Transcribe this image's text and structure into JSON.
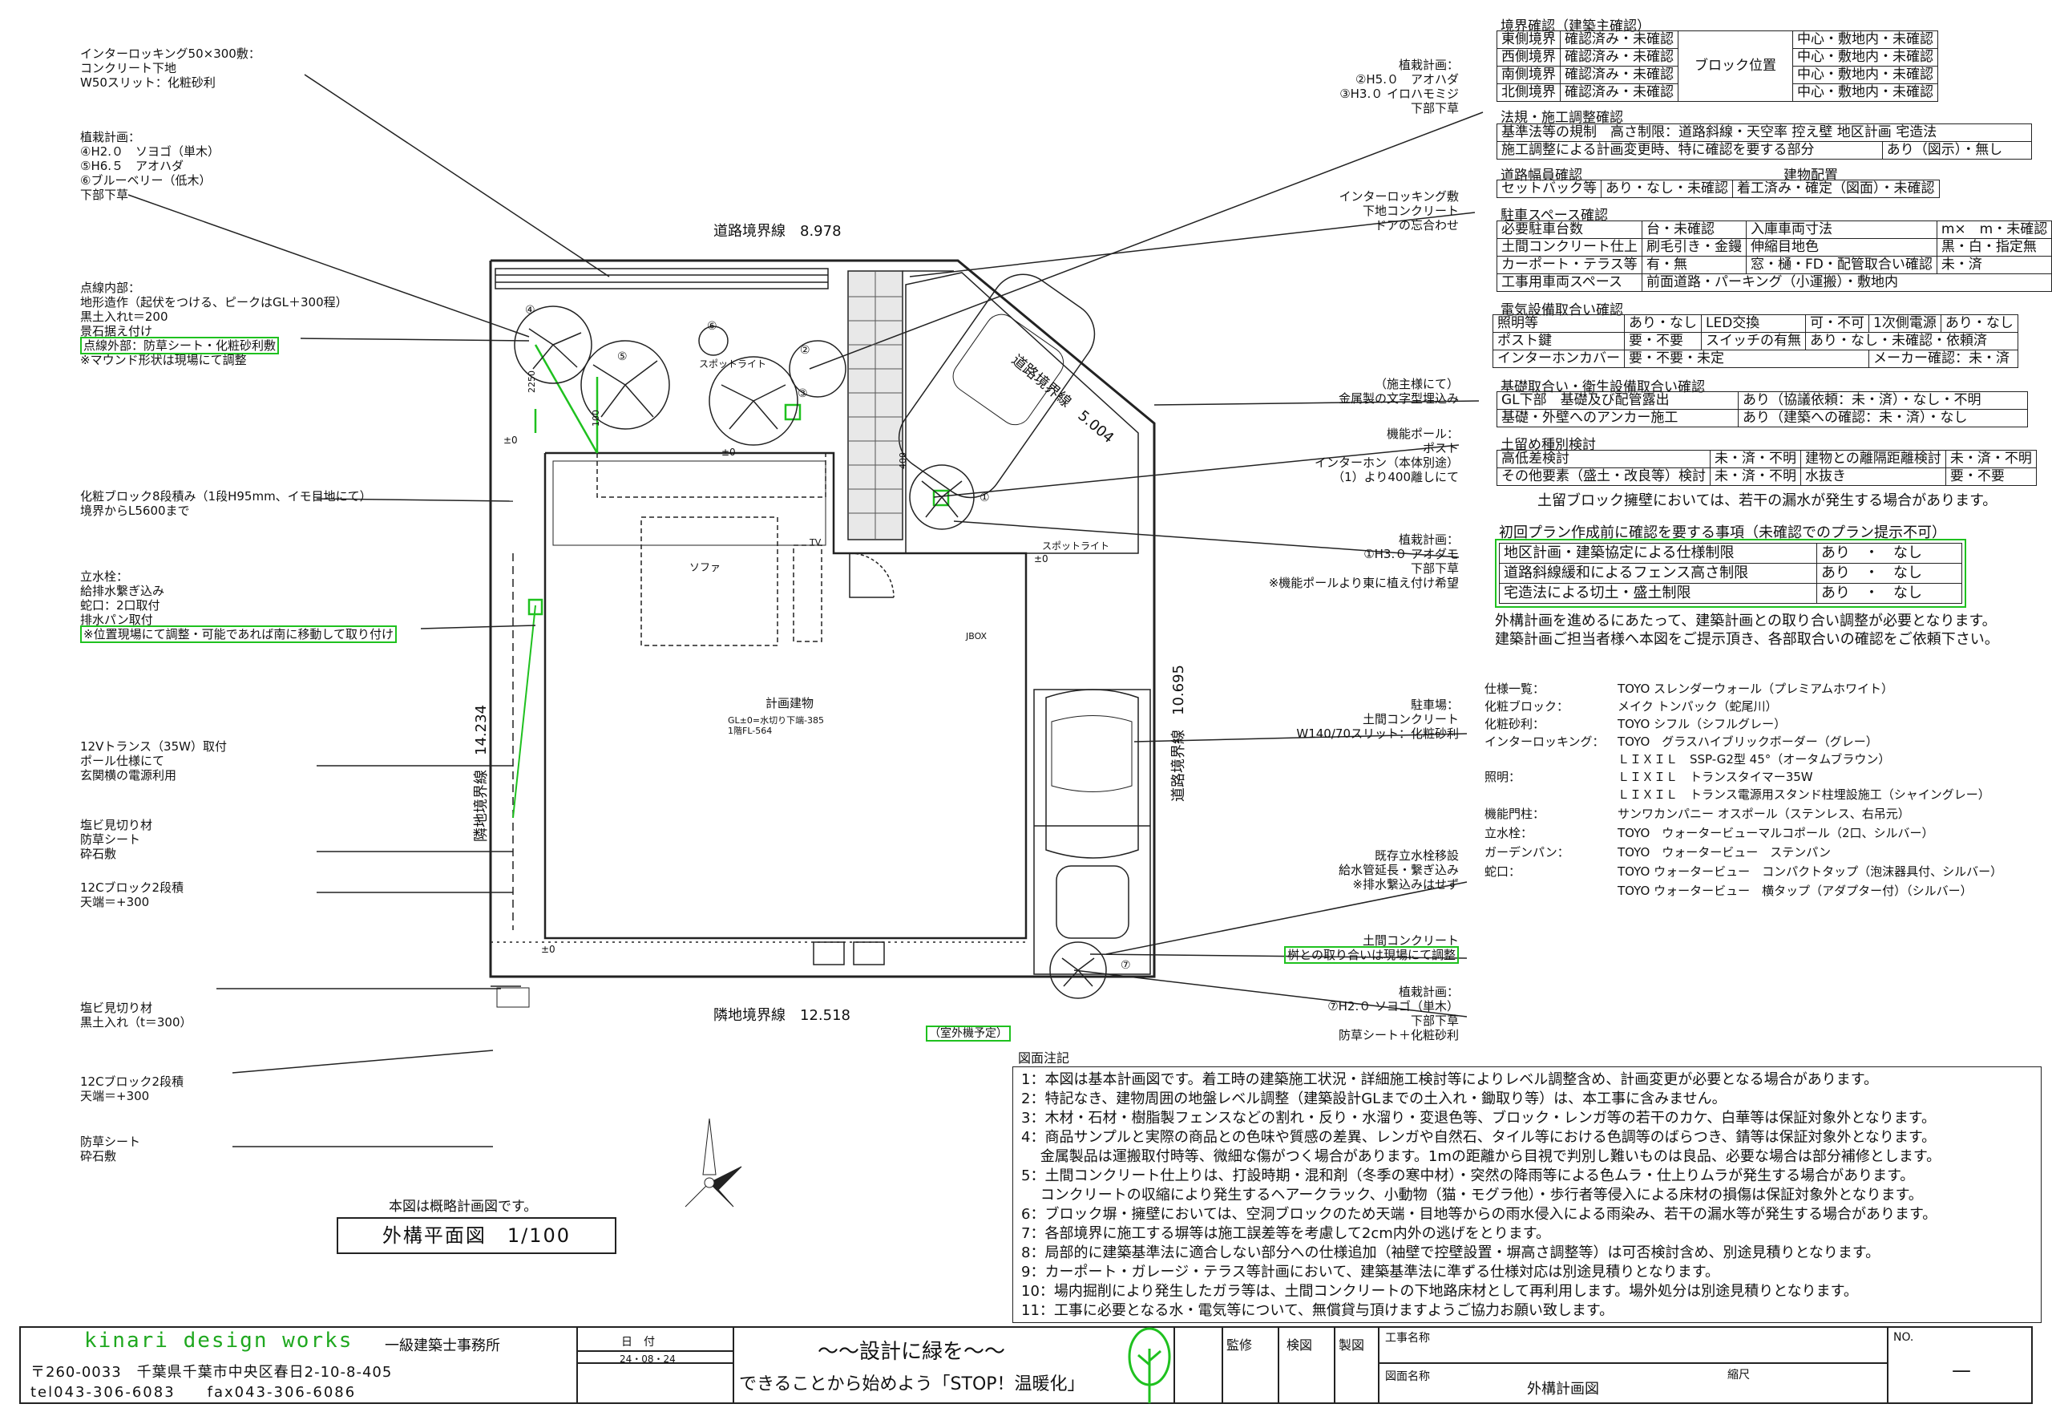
{
  "left_annotations": [
    {
      "id": "a1",
      "lines": [
        "インターロッキング50×300敷：",
        "コンクリート下地",
        "W50スリット：化粧砂利"
      ]
    },
    {
      "id": "a2",
      "lines": [
        "植栽計画：",
        "④H2.０　ソヨゴ（単木）",
        "⑤H6.５　アオハダ",
        "⑥ブルーベリー（低木）",
        "下部下草"
      ]
    },
    {
      "id": "a3",
      "lines": [
        "点線内部：",
        "地形造作（起伏をつける、ピークはGL＋300程）",
        "黒土入れt＝200",
        "景石据え付け"
      ]
    },
    {
      "id": "a3b",
      "text": "点線外部：防草シート・化粧砂利敷"
    },
    {
      "id": "a3c",
      "text": "※マウンド形状は現場にて調整"
    },
    {
      "id": "a4",
      "lines": [
        "化粧ブロック8段積み（1段H95mm、イモ目地にて）",
        "境界からL5600まで"
      ]
    },
    {
      "id": "a5",
      "lines": [
        "立水栓：",
        "給排水繋ぎ込み",
        "蛇口：2口取付",
        "排水パン取付"
      ]
    },
    {
      "id": "a5b",
      "text": "※位置現場にて調整・可能であれば南に移動して取り付け"
    },
    {
      "id": "a6",
      "lines": [
        "12Vトランス（35W）取付",
        "ポール仕様にて",
        "玄関横の電源利用"
      ]
    },
    {
      "id": "a7",
      "lines": [
        "塩ビ見切り材",
        "防草シート",
        "砕石敷"
      ]
    },
    {
      "id": "a8",
      "lines": [
        "12Cブロック2段積",
        "天端＝+300"
      ]
    },
    {
      "id": "a9",
      "lines": [
        "塩ビ見切り材",
        "黒土入れ（t＝300）"
      ]
    },
    {
      "id": "a10",
      "lines": [
        "12Cブロック2段積",
        "天端＝+300"
      ]
    },
    {
      "id": "a11",
      "lines": [
        "防草シート",
        "砕石敷"
      ]
    }
  ],
  "mid_annotations": [
    {
      "id": "m1",
      "lines": [
        "植栽計画：",
        "②H5.０　アオハダ",
        "③H3.０ イロハモミジ",
        "下部下草"
      ]
    },
    {
      "id": "m2",
      "lines": [
        "インターロッキング敷",
        "下地コンクリート",
        "ドアの忘合わせ"
      ]
    },
    {
      "id": "m3",
      "lines": [
        "（施主様にて）",
        "金属製の文字型埋込み"
      ]
    },
    {
      "id": "m4",
      "lines": [
        "機能ポール：",
        "ポスト",
        "インターホン（本体別途）",
        "（1）より400離しにて"
      ]
    },
    {
      "id": "m5",
      "lines": [
        "植栽計画：",
        "①H3.０ アオダモ",
        "下部下草",
        "※機能ポールより東に植え付け希望"
      ]
    },
    {
      "id": "m6",
      "lines": [
        "駐車場：",
        "土間コンクリート",
        "W140/70スリット：化粧砂利"
      ]
    },
    {
      "id": "m7",
      "lines": [
        "既存立水栓移設",
        "給水管延長・繋ぎ込み",
        "※排水繋込みはせず"
      ]
    },
    {
      "id": "m8",
      "text": "土間コンクリート"
    },
    {
      "id": "m8b",
      "text": "桝との取り合いは現場にて調整"
    },
    {
      "id": "m9",
      "lines": [
        "植栽計画：",
        "⑦H2.０ ソヨゴ（単木）",
        "下部下草",
        "防草シート＋化粧砂利"
      ]
    }
  ],
  "plan_labels": {
    "road_top": "道路境界線　8.978",
    "road_diag": "道路境界線　5.004",
    "road_right": "道路境界線　10.695",
    "neighbor_bottom": "隣地境界線　12.518",
    "neighbor_left": "隣地境界線　14.234",
    "building": "計画建物",
    "building_sub1": "GL±0=水切り下端-385",
    "building_sub2": "1階FL-564",
    "sofa": "ソファ",
    "tv": "TV",
    "jbox": "JBOX",
    "spot1": "スポットライト",
    "spot2": "スポットライト",
    "pm0a": "±0",
    "pm0b": "±0",
    "pm0c": "±0",
    "pm0d": "±0",
    "dim2250": "2250",
    "dim400": "400",
    "dim100": "100",
    "outdoor_unit": "（室外機予定）",
    "t1": "①",
    "t2": "②",
    "t3": "③",
    "t4": "④",
    "t5": "⑤",
    "t6": "⑥",
    "t7": "⑦"
  },
  "boundary": {
    "title": "境界確認（建築主確認）",
    "rows": [
      {
        "name": "東側境界",
        "status": "確認済み・未確認",
        "center": "中心・敷地内・未確認"
      },
      {
        "name": "西側境界",
        "status": "確認済み・未確認",
        "center": "中心・敷地内・未確認"
      },
      {
        "name": "南側境界",
        "status": "確認済み・未確認",
        "center": "中心・敷地内・未確認"
      },
      {
        "name": "北側境界",
        "status": "確認済み・未確認",
        "center": "中心・敷地内・未確認"
      }
    ],
    "block_pos": "ブロック位置"
  },
  "law": {
    "title": "法規・施工調整確認",
    "row1": "基準法等の規制　高さ制限：道路斜線・天空率  控え壁  地区計画  宅造法",
    "row2a": "施工調整による計画変更時、特に確認を要する部分",
    "row2b": "あり（図示）・無し"
  },
  "road": {
    "title": "道路幅員確認",
    "title2": "建物配置",
    "c1": "セットバック等",
    "c2": "あり・なし・未確認",
    "c3": "着工済み・確定（図面）・未確認"
  },
  "parking": {
    "title": "駐車スペース確認",
    "rows": [
      [
        "必要駐車台数",
        "台・未確認",
        "入庫車両寸法",
        "m×　m・未確認"
      ],
      [
        "土間コンクリート仕上",
        "刷毛引き・金鏝",
        "伸縮目地色",
        "黒・白・指定無"
      ],
      [
        "カーポート・テラス等",
        "有・無",
        "窓・樋・FD・配管取合い確認",
        "未・済"
      ],
      [
        "工事用車両スペース",
        "前面道路・パーキング（小運搬）・敷地内",
        "",
        ""
      ]
    ]
  },
  "electric": {
    "title": "電気設備取合い確認",
    "rows": [
      [
        "照明等",
        "あり・なし",
        "LED交換",
        "可・不可",
        "1次側電源",
        "あり・なし"
      ],
      [
        "ポスト鍵",
        "要・不要",
        "スイッチの有無",
        "あり・なし・未確認・依頼済",
        "",
        ""
      ],
      [
        "インターホンカバー",
        "要・不要・未定",
        "",
        "",
        "メーカー確認：未・済",
        ""
      ]
    ]
  },
  "foundation": {
    "title": "基礎取合い・衛生設備取合い確認",
    "rows": [
      [
        "GL下部　基礎及び配管露出",
        "あり（協議依頼：未・済）・なし・不明"
      ],
      [
        "基礎・外壁へのアンカー施工",
        "あり（建築への確認：未・済）・なし"
      ]
    ]
  },
  "retaining": {
    "title": "土留め種別検討",
    "rows": [
      [
        "高低差検討",
        "未・済・不明",
        "建物との離隔距離検討",
        "未・済・不明"
      ],
      [
        "その他要素（盛土・改良等）検討",
        "未・済・不明",
        "水抜き",
        "要・不要"
      ]
    ],
    "note": "土留ブロック擁壁においては、若干の漏水が発生する場合があります。"
  },
  "initial": {
    "title": "初回プラン作成前に確認を要する事項（未確認でのプラン提示不可）",
    "rows": [
      [
        "地区計画・建築協定による仕様制限",
        "あり　・　なし"
      ],
      [
        "道路斜線緩和によるフェンス高さ制限",
        "あり　・　なし"
      ],
      [
        "宅造法による切土・盛土制限",
        "あり　・　なし"
      ]
    ],
    "note1": "外構計画を進めるにあたって、建築計画との取り合い調整が必要となります。",
    "note2": "建築計画ご担当者様へ本図をご提示頂き、各部取合いの確認をご依頼下さい。"
  },
  "specs": [
    [
      "仕様一覧：",
      "TOYO スレンダーウォール（プレミアムホワイト）"
    ],
    [
      "化粧ブロック：",
      "メイク トンパック（蛇尾川）"
    ],
    [
      "化粧砂利：",
      "TOYO シフル（シフルグレー）"
    ],
    [
      "インターロッキング：",
      "TOYO　グラスハイブリックボーダー（グレー）"
    ],
    [
      "",
      "ＬＩＸＩＬ　SSP-G2型 45°（オータムブラウン）"
    ],
    [
      "照明：",
      "ＬＩＸＩＬ　トランスタイマー35W"
    ],
    [
      "",
      "ＬＩＸＩＬ　トランス電源用スタンド柱埋設施工（シャイングレー）"
    ],
    [
      "機能門柱：",
      "サンワカンパニー オスポール（ステンレス、右吊元）"
    ],
    [
      "立水栓：",
      "TOYO　ウォータービューマルコポール（2口、シルバー）"
    ],
    [
      "ガーデンパン：",
      "TOYO　ウォータービュー　ステンパン"
    ],
    [
      "蛇口：",
      "TOYO ウォータービュー　コンパクトタップ（泡沫器具付、シルバー）"
    ],
    [
      "",
      "TOYO ウォータービュー　横タップ（アダプター付）（シルバー）"
    ]
  ],
  "notes_title": "図面注記",
  "notes": [
    "1：本図は基本計画図です。着工時の建築施工状況・詳細施工検討等によりレベル調整含め、計画変更が必要となる場合があります。",
    "2：特記なき、建物周囲の地盤レベル調整（建築設計GLまでの土入れ・鋤取り等）は、本工事に含みません。",
    "3：木材・石材・樹脂製フェンスなどの割れ・反り・水溜り・変退色等、ブロック・レンガ等の若干のカケ、白華等は保証対象外となります。",
    "4：商品サンプルと実際の商品との色味や質感の差異、レンガや自然石、タイル等における色調等のばらつき、錆等は保証対象外となります。",
    "　 金属製品は運搬取付時等、微細な傷がつく場合があります。1mの距離から目視で判別し難いものは良品、必要な場合は部分補修とします。",
    "5：土間コンクリート仕上りは、打設時期・混和剤（冬季の寒中材）・突然の降雨等による色ムラ・仕上りムラが発生する場合があります。",
    "　 コンクリートの収縮により発生するヘアークラック、小動物（猫・モグラ他）・歩行者等侵入による床材の損傷は保証対象外となります。",
    "6：ブロック塀・擁壁においては、空洞ブロックのため天端・目地等からの雨水侵入による雨染み、若干の漏水等が発生する場合があります。",
    "7：各部境界に施工する塀等は施工誤差等を考慮して2cm内外の逃げをとります。",
    "8：局部的に建築基準法に適合しない部分への仕様追加（袖壁で控壁設置・塀高さ調整等）は可否検討含め、別途見積りとなります。",
    "9：カーポート・ガレージ・テラス等計画において、建築基準法に準ずる仕様対応は別途見積りとなります。",
    "10：場内掘削により発生したガラ等は、土間コンクリートの下地路床材として再利用します。場外処分は別途見積りとなります。",
    "11：工事に必要となる水・電気等について、無償貸与頂けますようご協力お願い致します。"
  ],
  "drawing_note": "本図は概略計画図です。",
  "drawing_title": "外構平面図　1/100",
  "title_block": {
    "company": "kinari design works",
    "office": "一級建築士事務所",
    "address": "〒260-0033　千葉県千葉市中央区春日2-10-8-405",
    "tel": "tel043-306-6083　　fax043-306-6086",
    "date_label": "日　付",
    "date": "24・08・24",
    "slogan1": "～～設計に緑を～～",
    "slogan2": "できることから始めよう「STOP！温暖化」",
    "kanshu": "監修",
    "kenzu": "検図",
    "seizu": "製図",
    "project_label": "工事名称",
    "drawing_label": "図面名称",
    "drawing_name": "外構計画図",
    "scale_label": "縮尺",
    "no_label": "NO.",
    "no_value": "—"
  },
  "colors": {
    "highlight": "#1fc11f",
    "line": "#222222",
    "brick": "#555555"
  }
}
